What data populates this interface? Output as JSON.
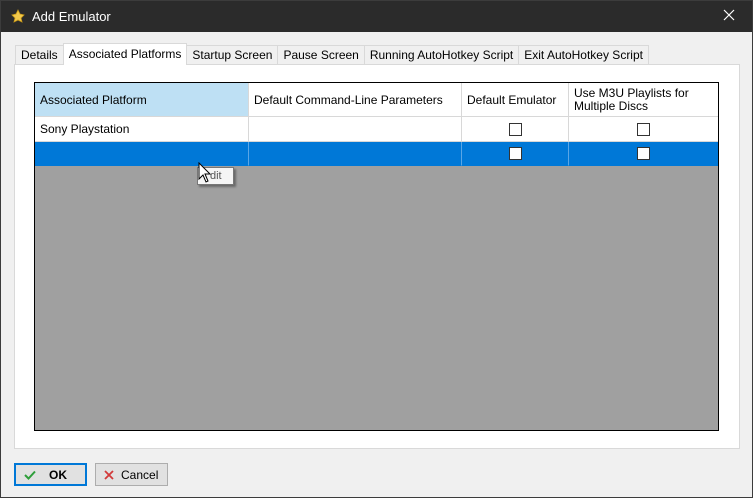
{
  "window": {
    "title": "Add Emulator"
  },
  "tabs": [
    {
      "label": "Details",
      "active": false
    },
    {
      "label": "Associated Platforms",
      "active": true
    },
    {
      "label": "Startup Screen",
      "active": false
    },
    {
      "label": "Pause Screen",
      "active": false
    },
    {
      "label": "Running AutoHotkey Script",
      "active": false
    },
    {
      "label": "Exit AutoHotkey Script",
      "active": false
    }
  ],
  "grid": {
    "columns": [
      "Associated Platform",
      "Default Command-Line Parameters",
      "Default Emulator",
      "Use M3U Playlists for Multiple Discs"
    ],
    "rows": [
      {
        "platform": "Sony Playstation",
        "params": "",
        "default_emulator": false,
        "use_m3u": false
      },
      {
        "platform": "",
        "params": "",
        "default_emulator": false,
        "use_m3u": false,
        "selected": true
      }
    ]
  },
  "tooltip": {
    "text": "dit"
  },
  "buttons": {
    "ok": "OK",
    "cancel": "Cancel"
  },
  "colors": {
    "selection": "#0078d7",
    "header_selected": "#bee0f4",
    "grid_background": "#a0a0a0",
    "titlebar": "#2b2b2b"
  }
}
